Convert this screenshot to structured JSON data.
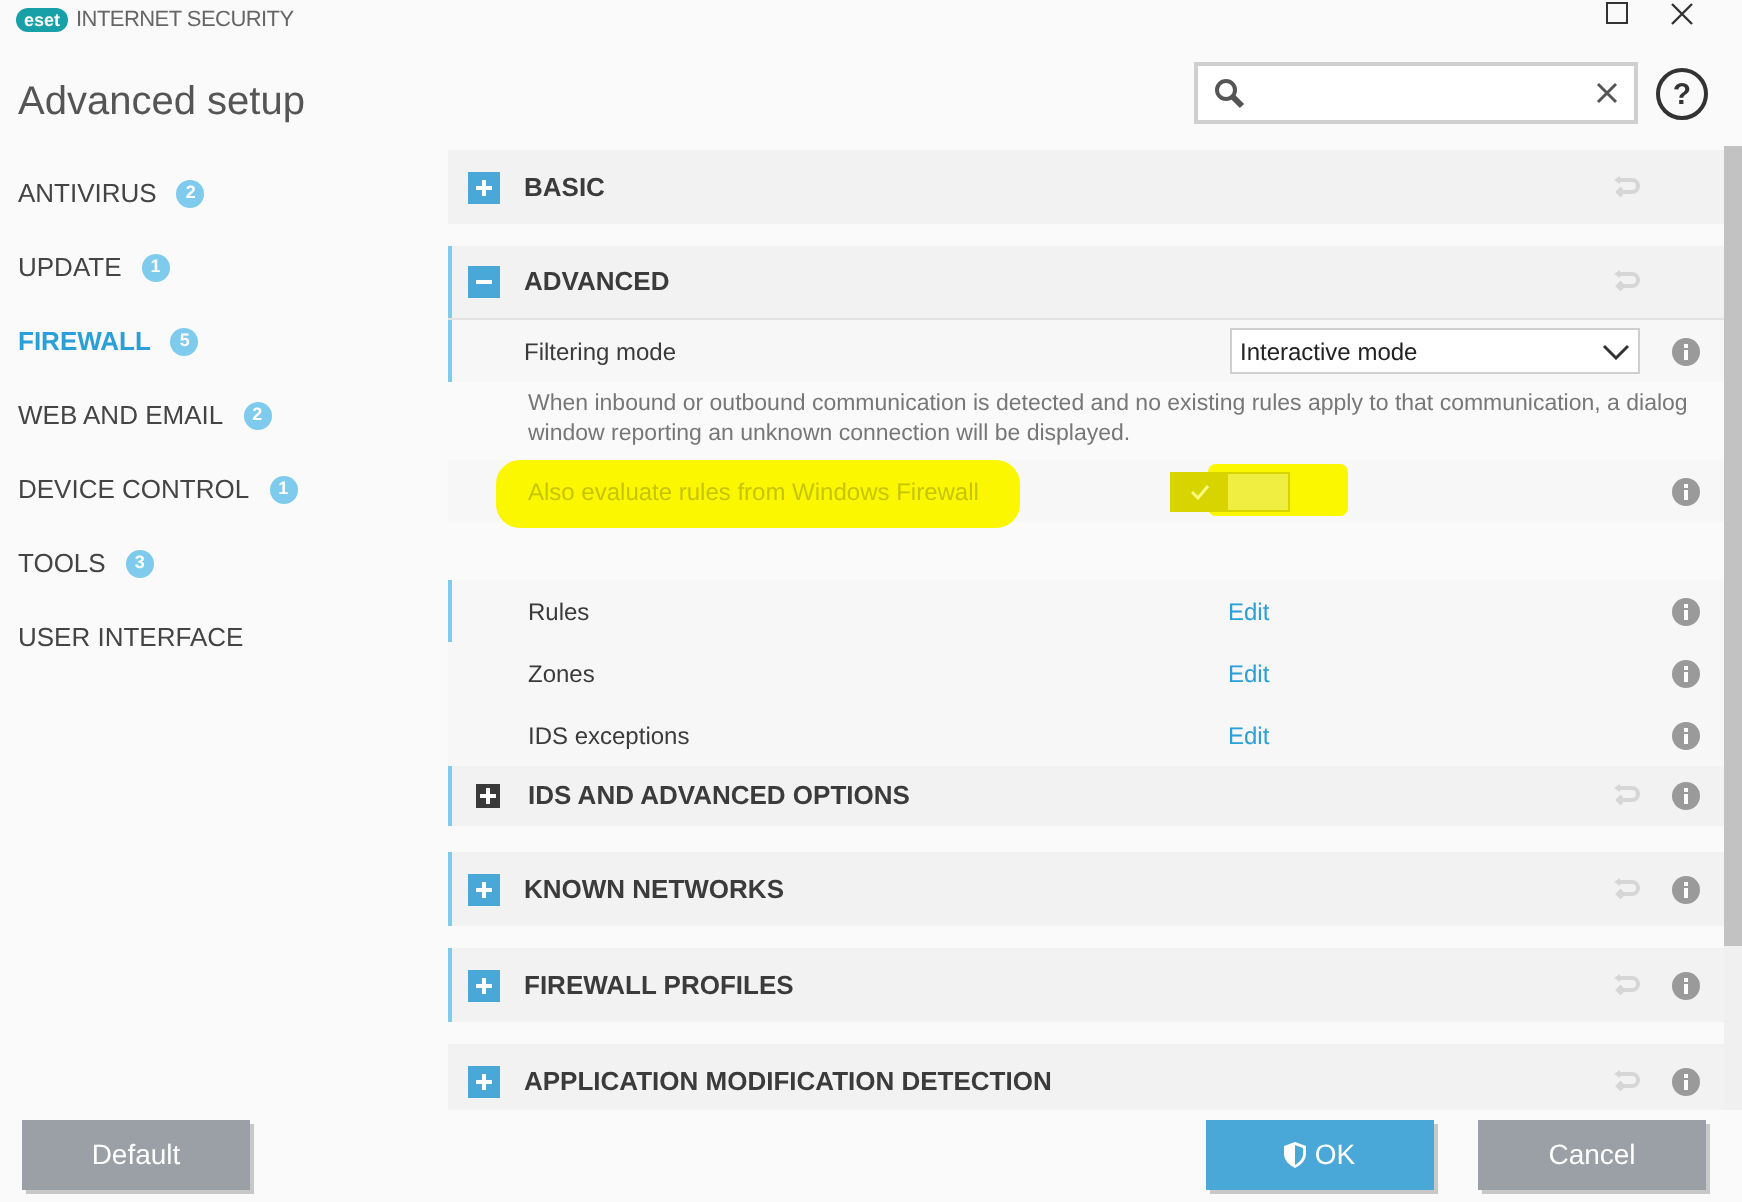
{
  "window": {
    "brand": "eset",
    "product": "INTERNET SECURITY",
    "title": "Advanced setup"
  },
  "sidebar": {
    "items": [
      {
        "label": "ANTIVIRUS",
        "count": "2",
        "selected": false
      },
      {
        "label": "UPDATE",
        "count": "1",
        "selected": false
      },
      {
        "label": "FIREWALL",
        "count": "5",
        "selected": true
      },
      {
        "label": "WEB AND EMAIL",
        "count": "2",
        "selected": false
      },
      {
        "label": "DEVICE CONTROL",
        "count": "1",
        "selected": false
      },
      {
        "label": "TOOLS",
        "count": "3",
        "selected": false
      },
      {
        "label": "USER INTERFACE",
        "selected": false
      }
    ]
  },
  "rows": [
    {
      "kind": "section",
      "label": "BASIC",
      "expanded": false,
      "accent": false,
      "info": false
    },
    {
      "kind": "section",
      "label": "ADVANCED",
      "expanded": true,
      "accent": true,
      "info": false
    },
    {
      "kind": "dropdown",
      "label": "Filtering mode",
      "value": "Interactive mode",
      "accent": true
    },
    {
      "kind": "note",
      "text": "When inbound or outbound communication is detected and no existing rules apply to that communication, a dialog window reporting an unknown connection will be displayed."
    },
    {
      "kind": "toggle",
      "label": "Also evaluate rules from Windows Firewall",
      "checked": true,
      "disabled": true,
      "highlighted": true
    },
    {
      "kind": "link",
      "label": "Rules",
      "link": "Edit",
      "accent": true
    },
    {
      "kind": "link",
      "label": "Zones",
      "link": "Edit",
      "accent": false
    },
    {
      "kind": "link",
      "label": "IDS exceptions",
      "link": "Edit",
      "accent": false
    },
    {
      "kind": "subsection",
      "label": "IDS AND ADVANCED OPTIONS",
      "expanded": false,
      "accent": true,
      "info": true
    },
    {
      "kind": "section",
      "label": "KNOWN NETWORKS",
      "expanded": false,
      "accent": true,
      "info": true
    },
    {
      "kind": "section",
      "label": "FIREWALL PROFILES",
      "expanded": false,
      "accent": true,
      "info": true
    },
    {
      "kind": "section",
      "label": "APPLICATION MODIFICATION DETECTION",
      "expanded": false,
      "accent": false,
      "info": true
    }
  ],
  "help": "?",
  "buttons": [
    {
      "label": "Default",
      "kind": "default"
    },
    {
      "label": "OK",
      "kind": "primary"
    },
    {
      "label": "Cancel",
      "kind": "cancel"
    }
  ]
}
